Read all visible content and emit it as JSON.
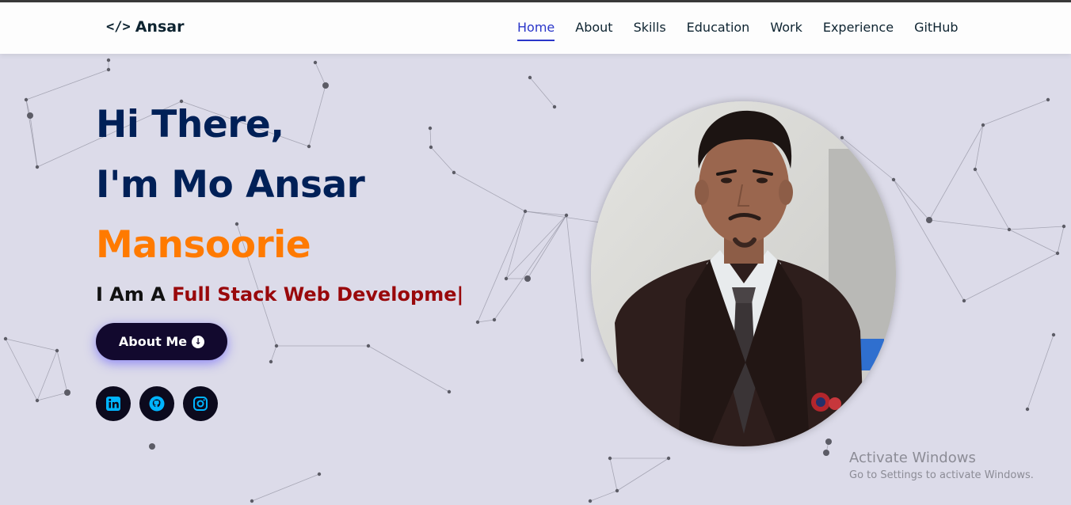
{
  "brand": {
    "code_glyph": "</>",
    "name": "Ansar"
  },
  "nav": {
    "items": [
      {
        "label": "Home",
        "active": true
      },
      {
        "label": "About",
        "active": false
      },
      {
        "label": "Skills",
        "active": false
      },
      {
        "label": "Education",
        "active": false
      },
      {
        "label": "Work",
        "active": false
      },
      {
        "label": "Experience",
        "active": false
      },
      {
        "label": "GitHub",
        "active": false
      }
    ]
  },
  "hero": {
    "line1": "Hi There,",
    "line2": "I'm Mo Ansar",
    "line3": "Mansoorie",
    "typed_prefix": "I Am A",
    "typed_role": "Full Stack Web Developme|",
    "button_label": "About Me",
    "button_icon": "arrow-down-circle-icon"
  },
  "socials": [
    {
      "name": "linkedin",
      "icon": "linkedin-icon"
    },
    {
      "name": "github",
      "icon": "github-icon"
    },
    {
      "name": "instagram",
      "icon": "instagram-icon"
    }
  ],
  "watermark": {
    "title": "Activate Windows",
    "subtitle": "Go to Settings to activate Windows."
  },
  "colors": {
    "navy": "#002057",
    "orange": "#ff7a00",
    "role_red": "#99080b",
    "nav_active": "#2a36c9",
    "background": "#dcdbe9",
    "social_icon": "#00b4ff"
  }
}
